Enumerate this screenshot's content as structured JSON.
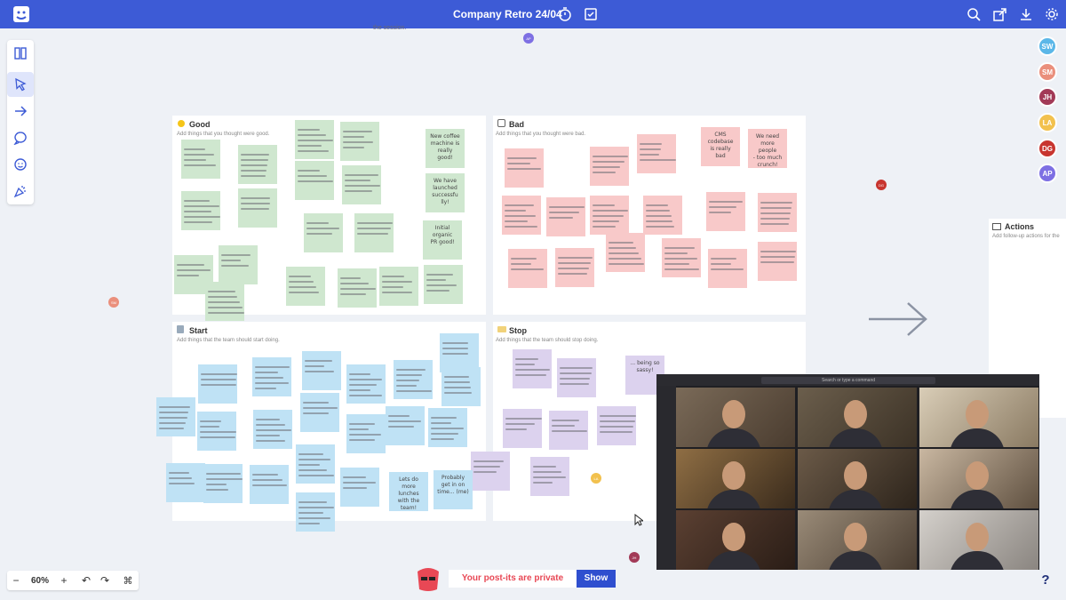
{
  "app": {
    "board_title": "Company Retro 24/04",
    "session_fragment": "the session."
  },
  "panels": {
    "good": {
      "title": "Good",
      "subtitle": "Add things that you thought were good."
    },
    "bad": {
      "title": "Bad",
      "subtitle": "Add things that you thought were bad."
    },
    "start": {
      "title": "Start",
      "subtitle": "Add things that the team should start doing."
    },
    "stop": {
      "title": "Stop",
      "subtitle": "Add things that the team should stop doing."
    },
    "actions": {
      "title": "Actions",
      "subtitle": "Add follow-up actions for the"
    }
  },
  "readable_notes": {
    "good": [
      "New coffee\nmachine is\nreally\ngood!",
      "We have\nlaunched\nsuccessfu\nlly!",
      "Initial\norganic\nPR good!"
    ],
    "bad": [
      "CMS\ncodebase\nis really\nbad",
      "We need\nmore people\n- too much\ncrunch!"
    ],
    "start": [
      "Lets do\nmore\nlunches\nwith the\nteam!",
      "Probably\nget in on\ntime... (me)"
    ],
    "stop": [
      "... being so\nsassy!"
    ]
  },
  "participants": [
    {
      "initials": "SW",
      "color": "#5bb7e8"
    },
    {
      "initials": "SM",
      "color": "#ea8f7c"
    },
    {
      "initials": "JH",
      "color": "#a23a57"
    },
    {
      "initials": "LA",
      "color": "#f2c14e"
    },
    {
      "initials": "DG",
      "color": "#c8352f"
    },
    {
      "initials": "AP",
      "color": "#7d6fe3"
    }
  ],
  "cursors": {
    "ap": "AP",
    "sm": "SM",
    "dg": "DG",
    "jh": "JH",
    "la": "LA"
  },
  "bottom": {
    "zoom": "60%",
    "minus": "−",
    "plus": "+",
    "undo": "↶",
    "redo": "↷",
    "cmd": "⌘",
    "help": "?"
  },
  "privacy": {
    "message": "Your post-its are private",
    "show_label": "Show"
  },
  "video_call": {
    "search_placeholder": "Search or type a command"
  },
  "colors": {
    "accent": "#3d5bd6",
    "good_note": "#cfe7cf",
    "bad_note": "#f8c9c9",
    "start_note": "#bfe2f5",
    "stop_note": "#dcd2ee"
  },
  "icons": {
    "logo": "dash-logo-icon",
    "timer": "stopwatch-icon",
    "vote": "vote-icon",
    "search": "search-icon",
    "share": "share-icon",
    "download": "download-icon",
    "settings": "gear-icon"
  }
}
